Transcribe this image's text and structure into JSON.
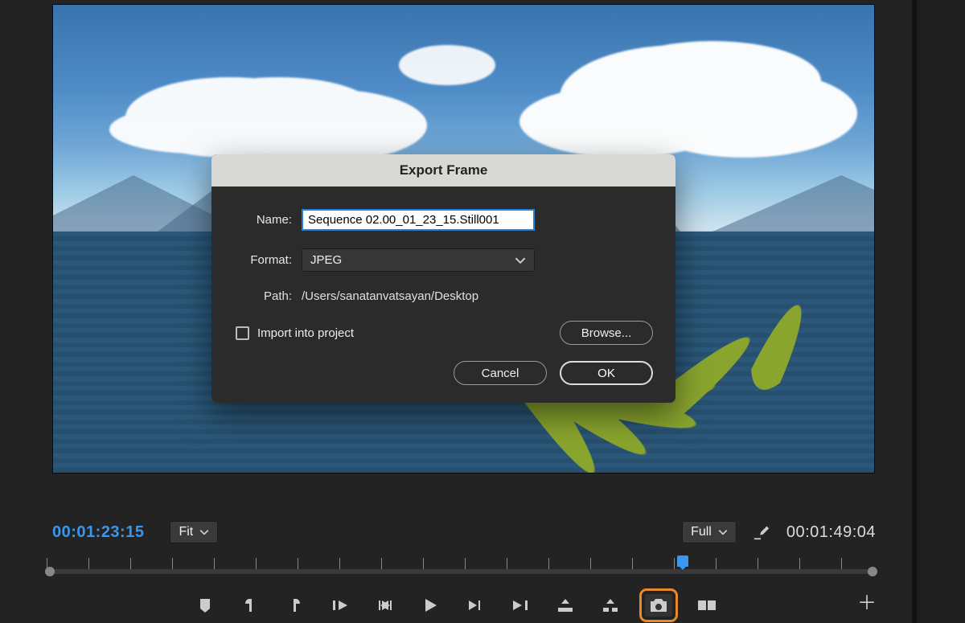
{
  "dialog": {
    "title": "Export Frame",
    "name_label": "Name:",
    "name_value": "Sequence 02.00_01_23_15.Still001",
    "format_label": "Format:",
    "format_value": "JPEG",
    "path_label": "Path:",
    "path_value": "/Users/sanatanvatsayan/Desktop",
    "import_label": "Import into project",
    "browse": "Browse...",
    "cancel": "Cancel",
    "ok": "OK"
  },
  "monitor": {
    "timecode_in": "00:01:23:15",
    "timecode_out": "00:01:49:04",
    "zoom": "Fit",
    "quality": "Full"
  },
  "timeline": {
    "playhead_pct": 76
  }
}
